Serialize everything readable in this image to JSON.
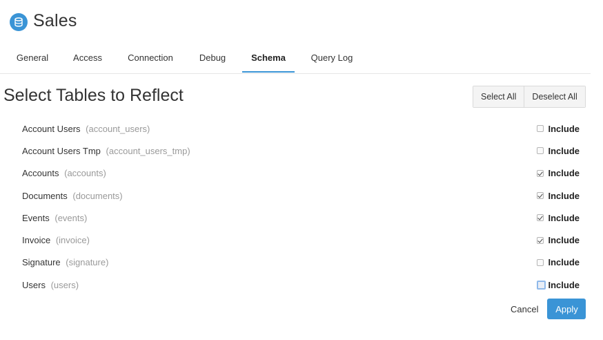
{
  "header": {
    "icon": "database-icon",
    "title": "Sales"
  },
  "tabs": [
    {
      "label": "General",
      "active": false
    },
    {
      "label": "Access",
      "active": false
    },
    {
      "label": "Connection",
      "active": false
    },
    {
      "label": "Debug",
      "active": false
    },
    {
      "label": "Schema",
      "active": true
    },
    {
      "label": "Query Log",
      "active": false
    }
  ],
  "section": {
    "title": "Select Tables to Reflect",
    "select_all_label": "Select All",
    "deselect_all_label": "Deselect All"
  },
  "tables": [
    {
      "name": "Account Users",
      "id": "(account_users)",
      "include_label": "Include",
      "checked": false
    },
    {
      "name": "Account Users Tmp",
      "id": "(account_users_tmp)",
      "include_label": "Include",
      "checked": false
    },
    {
      "name": "Accounts",
      "id": "(accounts)",
      "include_label": "Include",
      "checked": true
    },
    {
      "name": "Documents",
      "id": "(documents)",
      "include_label": "Include",
      "checked": true
    },
    {
      "name": "Events",
      "id": "(events)",
      "include_label": "Include",
      "checked": true
    },
    {
      "name": "Invoice",
      "id": "(invoice)",
      "include_label": "Include",
      "checked": true
    },
    {
      "name": "Signature",
      "id": "(signature)",
      "include_label": "Include",
      "checked": false
    },
    {
      "name": "Users",
      "id": "(users)",
      "include_label": "Include",
      "checked": false,
      "focused": true
    }
  ],
  "footer": {
    "cancel_label": "Cancel",
    "apply_label": "Apply"
  },
  "colors": {
    "accent": "#3a94d6",
    "muted_text": "#999999",
    "text": "#333333"
  }
}
